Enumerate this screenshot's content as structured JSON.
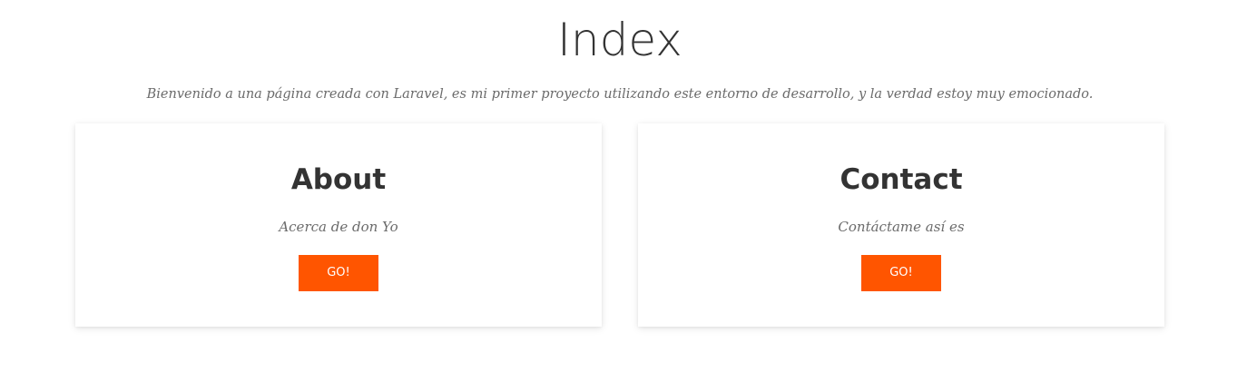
{
  "header": {
    "title": "Index",
    "subtitle": "Bienvenido a una página creada con Laravel, es mi primer proyecto utilizando este entorno de desarrollo, y la verdad estoy muy emocionado."
  },
  "cards": [
    {
      "title": "About",
      "text": "Acerca de don Yo",
      "button_label": "GO!"
    },
    {
      "title": "Contact",
      "text": "Contáctame así es",
      "button_label": "GO!"
    }
  ],
  "colors": {
    "accent": "#ff5500",
    "heading": "#333333",
    "body_text": "#6b6b6b",
    "background": "#ffffff"
  }
}
